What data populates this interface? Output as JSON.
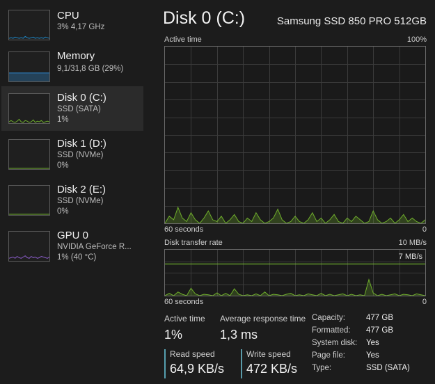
{
  "sidebar": {
    "items": [
      {
        "title": "CPU",
        "line1": "3%  4,17 GHz",
        "line2": "",
        "graph_color": "#1e88c8",
        "selected": false
      },
      {
        "title": "Memory",
        "line1": "9,1/31,8 GB (29%)",
        "line2": "",
        "graph_color": "#2e84c6",
        "selected": false
      },
      {
        "title": "Disk 0 (C:)",
        "line1": "SSD (SATA)",
        "line2": "1%",
        "graph_color": "#6fae2c",
        "selected": true
      },
      {
        "title": "Disk 1 (D:)",
        "line1": "SSD (NVMe)",
        "line2": "0%",
        "graph_color": "#6fae2c",
        "selected": false
      },
      {
        "title": "Disk 2 (E:)",
        "line1": "SSD (NVMe)",
        "line2": "0%",
        "graph_color": "#6fae2c",
        "selected": false
      },
      {
        "title": "GPU 0",
        "line1": "NVIDIA GeForce R...",
        "line2": "1%  (40 °C)",
        "graph_color": "#8a5cc8",
        "selected": false
      }
    ]
  },
  "main": {
    "title": "Disk 0 (C:)",
    "model": "Samsung SSD 850 PRO 512GB",
    "active_time_graph": {
      "label": "Active time",
      "max_label": "100%",
      "time_label": "60 seconds",
      "min_label": "0",
      "color": "#6fae2c",
      "values": [
        0,
        4,
        2,
        9,
        3,
        1,
        6,
        2,
        0,
        3,
        7,
        2,
        1,
        4,
        0,
        2,
        5,
        1,
        0,
        3,
        1,
        6,
        2,
        0,
        1,
        3,
        8,
        2,
        0,
        1,
        4,
        1,
        0,
        2,
        6,
        1,
        3,
        0,
        2,
        5,
        1,
        0,
        3,
        1,
        4,
        2,
        0,
        1,
        7,
        2,
        0,
        1,
        3,
        0,
        2,
        5,
        1,
        3,
        1,
        0,
        2
      ]
    },
    "transfer_graph": {
      "label": "Disk transfer rate",
      "max_label": "10 MB/s",
      "threshold_label": "7 MB/s",
      "time_label": "60 seconds",
      "min_label": "0",
      "color": "#6fae2c",
      "values": [
        0,
        0.5,
        0,
        0.8,
        0.3,
        0,
        1.6,
        0.4,
        0,
        0.3,
        0.2,
        0,
        0.6,
        0,
        0.5,
        0,
        1.5,
        0.3,
        0,
        0.2,
        0,
        0.4,
        0,
        0.8,
        0,
        0.3,
        0.2,
        0,
        0.3,
        0.5,
        0,
        0.2,
        0,
        0.4,
        0.2,
        0,
        0.5,
        0,
        0.3,
        0,
        0.2,
        0.4,
        0,
        0.3,
        0,
        0.2,
        0,
        3.5,
        0.6,
        0,
        0.3,
        0,
        0.2,
        0.4,
        0,
        0.3,
        0.2,
        0,
        0.4,
        0.2,
        0
      ]
    },
    "stats": {
      "active_time_label": "Active time",
      "active_time_value": "1%",
      "response_label": "Average response time",
      "response_value": "1,3 ms",
      "read_label": "Read speed",
      "read_value": "64,9 KB/s",
      "write_label": "Write speed",
      "write_value": "472 KB/s"
    },
    "properties": [
      {
        "key": "Capacity:",
        "value": "477 GB"
      },
      {
        "key": "Formatted:",
        "value": "477 GB"
      },
      {
        "key": "System disk:",
        "value": "Yes"
      },
      {
        "key": "Page file:",
        "value": "Yes"
      },
      {
        "key": "Type:",
        "value": "SSD (SATA)"
      }
    ]
  }
}
